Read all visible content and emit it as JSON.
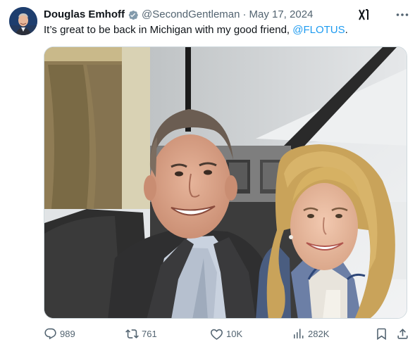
{
  "author": {
    "name": "Douglas Emhoff",
    "handle": "@SecondGentleman",
    "separator": "·",
    "date": "May 17, 2024",
    "verified": true
  },
  "tweet": {
    "text_before": "It’s great to be back in Michigan with my good friend, ",
    "mention": "@FLOTUS",
    "text_after": "."
  },
  "stats": {
    "replies": "989",
    "reposts": "761",
    "likes": "10K",
    "views": "282K"
  },
  "icons": {
    "verified": "verified-badge-icon",
    "grok": "grok-icon",
    "more": "more-icon",
    "reply": "reply-icon",
    "repost": "repost-icon",
    "like": "heart-icon",
    "views": "views-icon",
    "bookmark": "bookmark-icon",
    "share": "share-icon"
  },
  "colors": {
    "text": "#0f1419",
    "secondary": "#536471",
    "link": "#1d9bf0",
    "verified_badge": "#829aab"
  }
}
